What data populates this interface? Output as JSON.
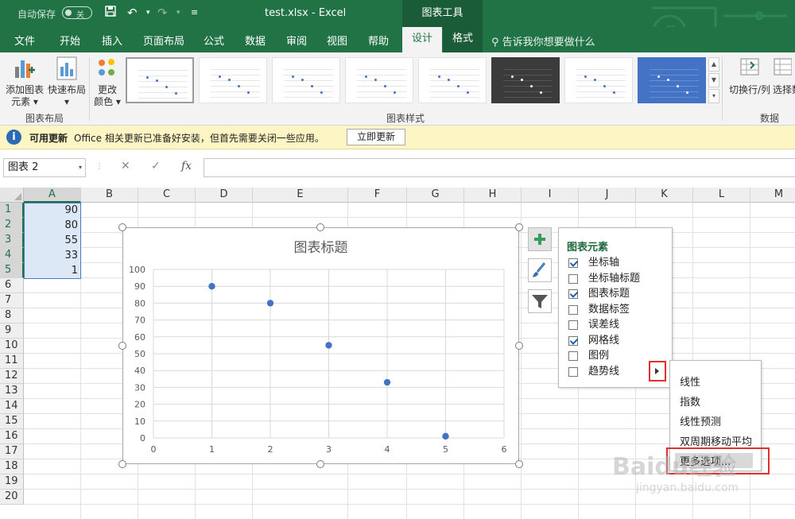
{
  "titlebar": {
    "autosave": "自动保存",
    "autosave_state": "关",
    "doc_title": "test.xlsx  -  Excel",
    "tools_label": "图表工具",
    "bg_color": "#217346"
  },
  "tabs": [
    {
      "label": "文件"
    },
    {
      "label": "开始"
    },
    {
      "label": "插入"
    },
    {
      "label": "页面布局"
    },
    {
      "label": "公式"
    },
    {
      "label": "数据"
    },
    {
      "label": "审阅"
    },
    {
      "label": "视图"
    },
    {
      "label": "帮助"
    },
    {
      "label": "设计"
    },
    {
      "label": "格式"
    }
  ],
  "search": {
    "text": "告诉我你想要做什么"
  },
  "ribbon": {
    "add_element_1": "添加图表",
    "add_element_2": "元素",
    "quick_layout": "快速布局",
    "change_color_1": "更改",
    "change_color_2": "颜色",
    "group_layout": "图表布局",
    "group_styles": "图表样式",
    "switch_rowcol": "切换行/列",
    "select_data": "选择数",
    "group_data": "数据"
  },
  "infobar": {
    "title": "可用更新",
    "message": "Office 相关更新已准备好安装，但首先需要关闭一些应用。",
    "button": "立即更新",
    "icon": "i"
  },
  "formula_bar": {
    "name_box": "图表 2",
    "fx": "fx",
    "value": ""
  },
  "columns": [
    "A",
    "B",
    "C",
    "D",
    "E",
    "F",
    "G",
    "H",
    "I",
    "J",
    "K",
    "L",
    "M"
  ],
  "rows": [
    "1",
    "2",
    "3",
    "4",
    "5",
    "6",
    "7",
    "8",
    "9",
    "10",
    "11",
    "12",
    "13",
    "14",
    "15",
    "16",
    "17",
    "18",
    "19",
    "20"
  ],
  "cells_A": [
    "90",
    "80",
    "55",
    "33",
    "1"
  ],
  "chart": {
    "title": "图表标题"
  },
  "chart_data": {
    "type": "scatter",
    "title": "图表标题",
    "x": [
      1,
      2,
      3,
      4,
      5
    ],
    "y": [
      90,
      80,
      55,
      33,
      1
    ],
    "xlim": [
      0,
      6
    ],
    "ylim": [
      0,
      100
    ],
    "x_ticks": [
      "0",
      "1",
      "2",
      "3",
      "4",
      "5",
      "6"
    ],
    "y_ticks": [
      "0",
      "10",
      "20",
      "30",
      "40",
      "50",
      "60",
      "70",
      "80",
      "90",
      "100"
    ],
    "grid": true,
    "marker_color": "#4472c4"
  },
  "elements_panel": {
    "title": "图表元素",
    "options": [
      {
        "label": "坐标轴",
        "checked": true
      },
      {
        "label": "坐标轴标题",
        "checked": false
      },
      {
        "label": "图表标题",
        "checked": true
      },
      {
        "label": "数据标签",
        "checked": false
      },
      {
        "label": "误差线",
        "checked": false
      },
      {
        "label": "网格线",
        "checked": true
      },
      {
        "label": "图例",
        "checked": false
      },
      {
        "label": "趋势线",
        "checked": false
      }
    ]
  },
  "trendline_menu": [
    "线性",
    "指数",
    "线性预测",
    "双周期移动平均",
    "更多选项..."
  ],
  "watermark": {
    "brand": "Baidu经验",
    "url": "jingyan.baidu.com"
  }
}
